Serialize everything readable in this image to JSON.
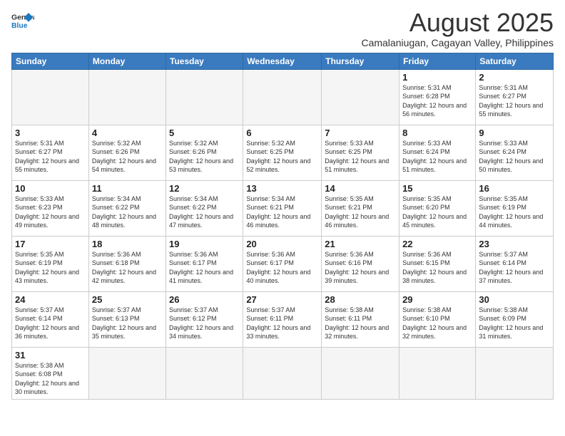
{
  "logo": {
    "general": "General",
    "blue": "Blue"
  },
  "title": "August 2025",
  "location": "Camalaniugan, Cagayan Valley, Philippines",
  "days_of_week": [
    "Sunday",
    "Monday",
    "Tuesday",
    "Wednesday",
    "Thursday",
    "Friday",
    "Saturday"
  ],
  "weeks": [
    [
      {
        "day": "",
        "info": ""
      },
      {
        "day": "",
        "info": ""
      },
      {
        "day": "",
        "info": ""
      },
      {
        "day": "",
        "info": ""
      },
      {
        "day": "",
        "info": ""
      },
      {
        "day": "1",
        "info": "Sunrise: 5:31 AM\nSunset: 6:28 PM\nDaylight: 12 hours and 56 minutes."
      },
      {
        "day": "2",
        "info": "Sunrise: 5:31 AM\nSunset: 6:27 PM\nDaylight: 12 hours and 55 minutes."
      }
    ],
    [
      {
        "day": "3",
        "info": "Sunrise: 5:31 AM\nSunset: 6:27 PM\nDaylight: 12 hours and 55 minutes."
      },
      {
        "day": "4",
        "info": "Sunrise: 5:32 AM\nSunset: 6:26 PM\nDaylight: 12 hours and 54 minutes."
      },
      {
        "day": "5",
        "info": "Sunrise: 5:32 AM\nSunset: 6:26 PM\nDaylight: 12 hours and 53 minutes."
      },
      {
        "day": "6",
        "info": "Sunrise: 5:32 AM\nSunset: 6:25 PM\nDaylight: 12 hours and 52 minutes."
      },
      {
        "day": "7",
        "info": "Sunrise: 5:33 AM\nSunset: 6:25 PM\nDaylight: 12 hours and 51 minutes."
      },
      {
        "day": "8",
        "info": "Sunrise: 5:33 AM\nSunset: 6:24 PM\nDaylight: 12 hours and 51 minutes."
      },
      {
        "day": "9",
        "info": "Sunrise: 5:33 AM\nSunset: 6:24 PM\nDaylight: 12 hours and 50 minutes."
      }
    ],
    [
      {
        "day": "10",
        "info": "Sunrise: 5:33 AM\nSunset: 6:23 PM\nDaylight: 12 hours and 49 minutes."
      },
      {
        "day": "11",
        "info": "Sunrise: 5:34 AM\nSunset: 6:22 PM\nDaylight: 12 hours and 48 minutes."
      },
      {
        "day": "12",
        "info": "Sunrise: 5:34 AM\nSunset: 6:22 PM\nDaylight: 12 hours and 47 minutes."
      },
      {
        "day": "13",
        "info": "Sunrise: 5:34 AM\nSunset: 6:21 PM\nDaylight: 12 hours and 46 minutes."
      },
      {
        "day": "14",
        "info": "Sunrise: 5:35 AM\nSunset: 6:21 PM\nDaylight: 12 hours and 46 minutes."
      },
      {
        "day": "15",
        "info": "Sunrise: 5:35 AM\nSunset: 6:20 PM\nDaylight: 12 hours and 45 minutes."
      },
      {
        "day": "16",
        "info": "Sunrise: 5:35 AM\nSunset: 6:19 PM\nDaylight: 12 hours and 44 minutes."
      }
    ],
    [
      {
        "day": "17",
        "info": "Sunrise: 5:35 AM\nSunset: 6:19 PM\nDaylight: 12 hours and 43 minutes."
      },
      {
        "day": "18",
        "info": "Sunrise: 5:36 AM\nSunset: 6:18 PM\nDaylight: 12 hours and 42 minutes."
      },
      {
        "day": "19",
        "info": "Sunrise: 5:36 AM\nSunset: 6:17 PM\nDaylight: 12 hours and 41 minutes."
      },
      {
        "day": "20",
        "info": "Sunrise: 5:36 AM\nSunset: 6:17 PM\nDaylight: 12 hours and 40 minutes."
      },
      {
        "day": "21",
        "info": "Sunrise: 5:36 AM\nSunset: 6:16 PM\nDaylight: 12 hours and 39 minutes."
      },
      {
        "day": "22",
        "info": "Sunrise: 5:36 AM\nSunset: 6:15 PM\nDaylight: 12 hours and 38 minutes."
      },
      {
        "day": "23",
        "info": "Sunrise: 5:37 AM\nSunset: 6:14 PM\nDaylight: 12 hours and 37 minutes."
      }
    ],
    [
      {
        "day": "24",
        "info": "Sunrise: 5:37 AM\nSunset: 6:14 PM\nDaylight: 12 hours and 36 minutes."
      },
      {
        "day": "25",
        "info": "Sunrise: 5:37 AM\nSunset: 6:13 PM\nDaylight: 12 hours and 35 minutes."
      },
      {
        "day": "26",
        "info": "Sunrise: 5:37 AM\nSunset: 6:12 PM\nDaylight: 12 hours and 34 minutes."
      },
      {
        "day": "27",
        "info": "Sunrise: 5:37 AM\nSunset: 6:11 PM\nDaylight: 12 hours and 33 minutes."
      },
      {
        "day": "28",
        "info": "Sunrise: 5:38 AM\nSunset: 6:11 PM\nDaylight: 12 hours and 32 minutes."
      },
      {
        "day": "29",
        "info": "Sunrise: 5:38 AM\nSunset: 6:10 PM\nDaylight: 12 hours and 32 minutes."
      },
      {
        "day": "30",
        "info": "Sunrise: 5:38 AM\nSunset: 6:09 PM\nDaylight: 12 hours and 31 minutes."
      }
    ],
    [
      {
        "day": "31",
        "info": "Sunrise: 5:38 AM\nSunset: 6:08 PM\nDaylight: 12 hours and 30 minutes."
      },
      {
        "day": "",
        "info": ""
      },
      {
        "day": "",
        "info": ""
      },
      {
        "day": "",
        "info": ""
      },
      {
        "day": "",
        "info": ""
      },
      {
        "day": "",
        "info": ""
      },
      {
        "day": "",
        "info": ""
      }
    ]
  ]
}
